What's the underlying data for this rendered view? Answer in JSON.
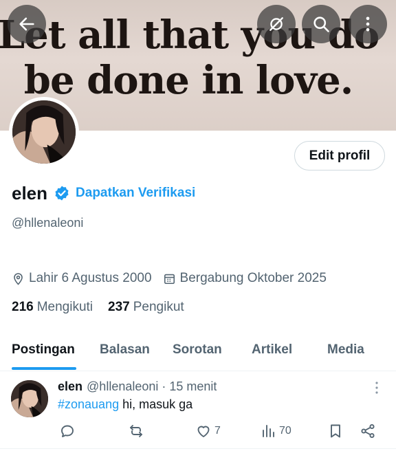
{
  "banner": {
    "line1": "Let all that you do",
    "line2": "be done in love."
  },
  "header": {
    "back_icon": "arrow-left-icon",
    "grok_icon": "grok-icon",
    "search_icon": "search-icon",
    "more_icon": "more-vertical-icon"
  },
  "profile": {
    "edit_label": "Edit profil",
    "name": "elen",
    "verify_label": "Dapatkan Verifikasi",
    "handle": "@hllenaleoni",
    "birth": "Lahir 6 Agustus 2000",
    "joined": "Bergabung Oktober 2025",
    "following_count": "216",
    "following_label": "Mengikuti",
    "followers_count": "237",
    "followers_label": "Pengikut"
  },
  "tabs": [
    {
      "label": "Postingan",
      "active": true
    },
    {
      "label": "Balasan"
    },
    {
      "label": "Sorotan"
    },
    {
      "label": "Artikel"
    },
    {
      "label": "Media"
    }
  ],
  "post": {
    "author": "elen",
    "meta": "@hllenaleoni · 15 menit",
    "hashtag": "#zonauang",
    "text": " hi, masuk ga",
    "likes": "7",
    "views": "70"
  },
  "colors": {
    "accent": "#1d9bf0",
    "text": "#0f1419",
    "muted": "#536471"
  }
}
